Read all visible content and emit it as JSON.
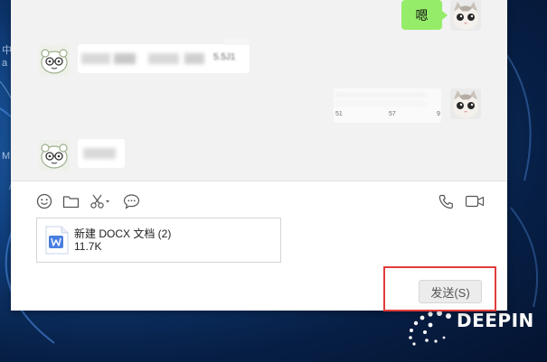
{
  "desktop": {
    "left_fragments": [
      "中",
      "a",
      "M"
    ],
    "brand_text": "DEEPIN"
  },
  "chat": {
    "messages": [
      {
        "side": "right",
        "type": "text",
        "text": "嗯",
        "avatar": "cat-avatar"
      },
      {
        "side": "left",
        "type": "blurred-text",
        "tail_text": "5.5J1",
        "avatar": "cartoon-avatar"
      },
      {
        "side": "right",
        "type": "blurred-table",
        "numbers": [
          "51",
          "57",
          "9"
        ],
        "avatar": "cat-avatar"
      },
      {
        "side": "left",
        "type": "blurred-text",
        "avatar": "cartoon-avatar"
      }
    ]
  },
  "toolbar": {
    "left_icons": [
      "emoji-icon",
      "folder-icon",
      "scissors-icon",
      "chat-bubble-icon"
    ],
    "right_icons": [
      "phone-icon",
      "video-icon"
    ]
  },
  "attachment": {
    "name": "新建 DOCX 文档 (2)",
    "size": "11.7K",
    "icon": "word-document-icon",
    "icon_color": "#4a7fe0"
  },
  "send_button": {
    "label": "发送(S)"
  },
  "colors": {
    "bubble_green": "#95ec69",
    "highlight_red": "#e23b3b"
  }
}
